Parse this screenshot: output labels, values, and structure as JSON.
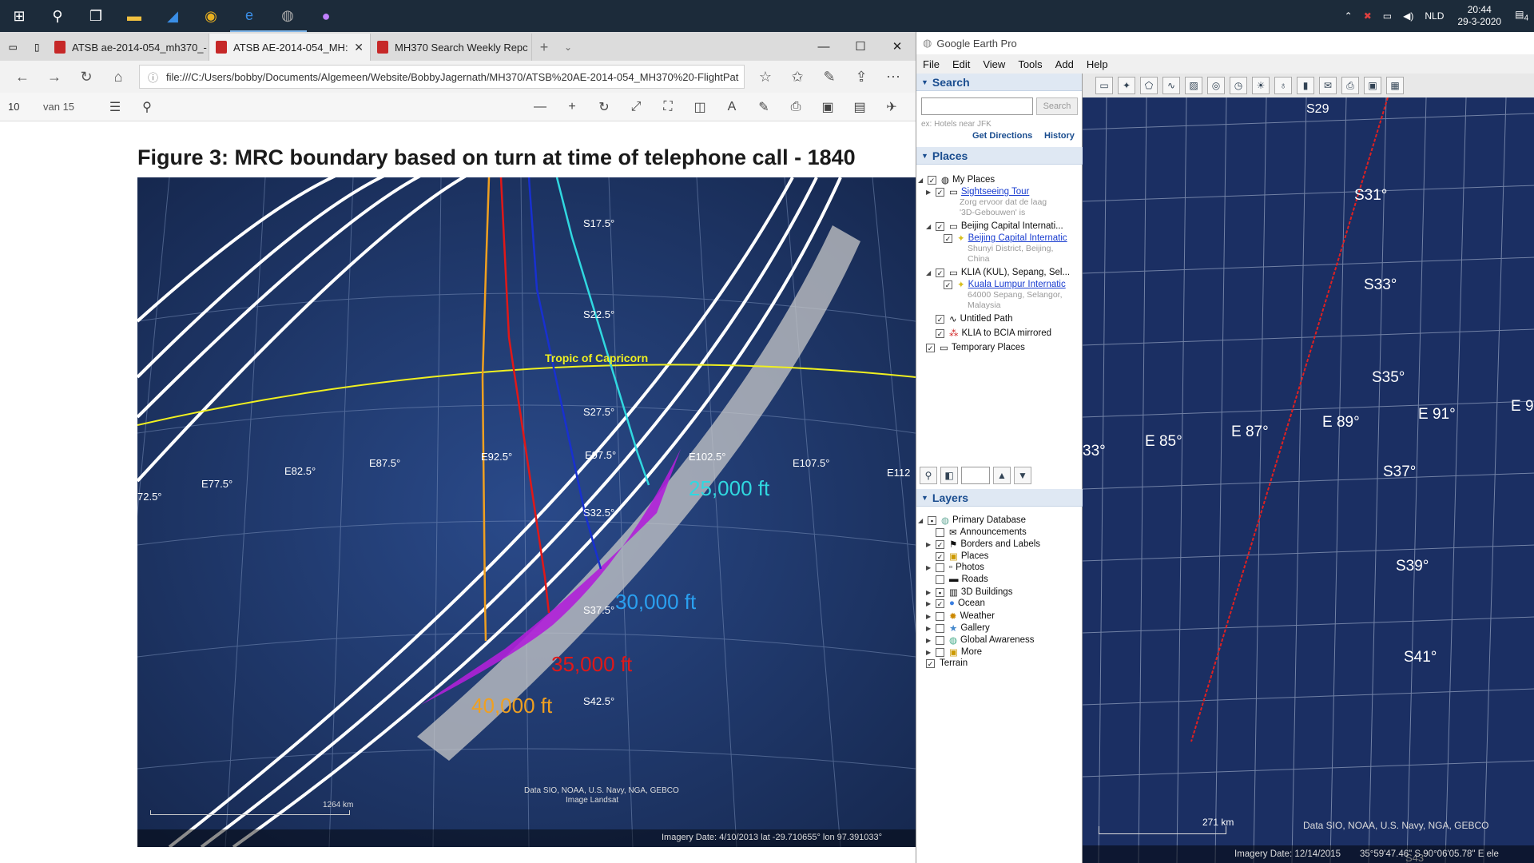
{
  "taskbar": {
    "time": "20:44",
    "date": "29-3-2020",
    "lang": "NLD",
    "notifications": "4"
  },
  "edge": {
    "tabs": [
      {
        "label": "ATSB ae-2014-054_mh370_-"
      },
      {
        "label": "ATSB AE-2014-054_MH:"
      },
      {
        "label": "MH370 Search Weekly Repc"
      }
    ],
    "address": "file:///C:/Users/bobby/Documents/Algemeen/Website/BobbyJagernath/MH370/ATSB%20AE-2014-054_MH370%20-FlightPat",
    "page_num": "10",
    "page_total": "van 15"
  },
  "figure": {
    "title": "Figure 3: MRC boundary based on turn at time of telephone call - 1840",
    "lon_labels": [
      "72.5°",
      "E77.5°",
      "E82.5°",
      "E87.5°",
      "E92.5°",
      "E97.5°",
      "E102.5°",
      "E107.5°",
      "E112"
    ],
    "lat_labels": [
      "S17.5°",
      "S22.5°",
      "S27.5°",
      "S32.5°",
      "S37.5°",
      "S42.5°"
    ],
    "tropic": "Tropic of Capricorn",
    "alt_25000": "25,000 ft",
    "alt_30000": "30,000 ft",
    "alt_35000": "35,000 ft",
    "alt_40000": "40,000 ft",
    "credit1": "Data SIO, NOAA, U.S. Navy, NGA, GEBCO",
    "credit2": "Image Landsat",
    "scale": "1264 km",
    "status": "Imagery Date: 4/10/2013     lat  -29.710655°  lon   97.391033°",
    "colors": {
      "orange": "#f0a020",
      "red": "#e01818",
      "blue": "#1830d0",
      "cyan": "#30d8e0",
      "purple": "#b020d8",
      "yellow": "#f0f020"
    }
  },
  "ge": {
    "title": "Google Earth Pro",
    "menu": [
      "File",
      "Edit",
      "View",
      "Tools",
      "Add",
      "Help"
    ],
    "search_header": "Search",
    "search_btn": "Search",
    "search_hint": "ex: Hotels near JFK",
    "get_directions": "Get Directions",
    "history": "History",
    "places_header": "Places",
    "places": {
      "my_places": "My Places",
      "sightseeing": "Sightseeing Tour",
      "sightseeing_desc1": "Zorg ervoor dat de laag",
      "sightseeing_desc2": "'3D-Gebouwen' is",
      "beijing": "Beijing Capital Internati...",
      "beijing_link": "Beijing Capital Internatic",
      "beijing_desc1": "Shunyi District, Beijing,",
      "beijing_desc2": "China",
      "klia": "KLIA (KUL), Sepang, Sel...",
      "klia_link": "Kuala Lumpur Internatic",
      "klia_desc1": "64000 Sepang, Selangor,",
      "klia_desc2": "Malaysia",
      "untitled": "Untitled Path",
      "mirrored": "KLIA to BCIA mirrored",
      "temporary": "Temporary Places"
    },
    "layers_header": "Layers",
    "layers": [
      "Primary Database",
      "Announcements",
      "Borders and Labels",
      "Places",
      "Photos",
      "Roads",
      "3D Buildings",
      "Ocean",
      "Weather",
      "Gallery",
      "Global Awareness",
      "More",
      "Terrain"
    ],
    "map": {
      "lat_labels": [
        "S29",
        "S31°",
        "S33°",
        "S35°",
        "S37°",
        "S39°",
        "S41°",
        "S43"
      ],
      "lon_labels": [
        "33°",
        "E 85°",
        "E 87°",
        "E 89°",
        "E 91°",
        "E 9"
      ],
      "scale": "271 km",
      "credit": "Data SIO, NOAA, U.S. Navy, NGA, GEBCO",
      "imagery_date": "Imagery Date: 12/14/2015",
      "coords": "35°59'47.46\" S   90°06'05.78\" E  ele"
    }
  }
}
